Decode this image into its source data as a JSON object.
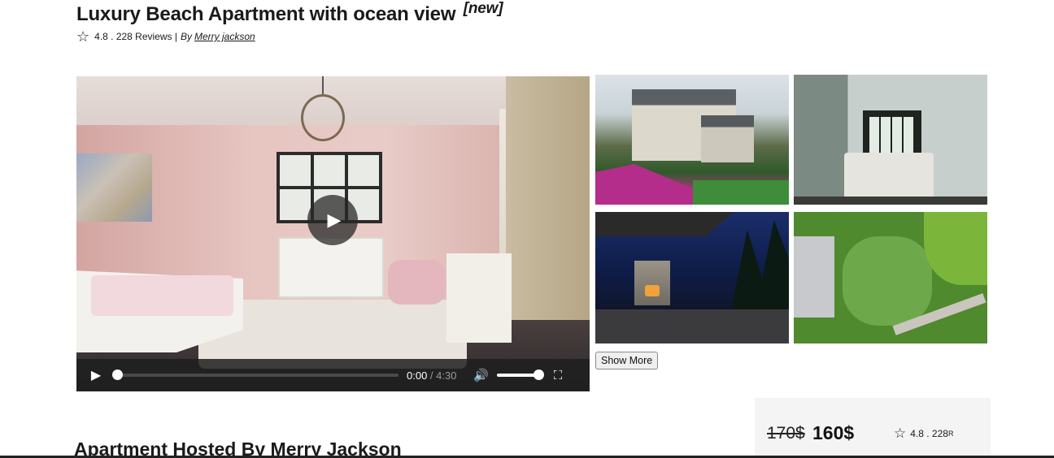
{
  "listing": {
    "title": "Luxury Beach Apartment with ocean view",
    "tag": "[new]",
    "rating": "4.8 . 228 Reviews | ",
    "by_prefix": "By",
    "host_link": "Merry jackson",
    "star_icon": "☆"
  },
  "video": {
    "play_icon": "▶",
    "current_time": "0:00",
    "separator": " / ",
    "total_time": "4:30",
    "volume_icon": "🔊",
    "fullscreen_icon": "⛶",
    "progress": 0.0,
    "volume_level": 1.0
  },
  "gallery": {
    "show_more_label": "Show More",
    "photos": [
      "house-exterior",
      "bedroom",
      "patio-night",
      "garden-aerial"
    ]
  },
  "host_section": {
    "title": "Apartment Hosted By Merry Jackson"
  },
  "price_card": {
    "old_price": "170$",
    "new_price": "160$",
    "rating": "4.8 . 228",
    "rating_suffix": "R",
    "star_icon": "☆"
  }
}
